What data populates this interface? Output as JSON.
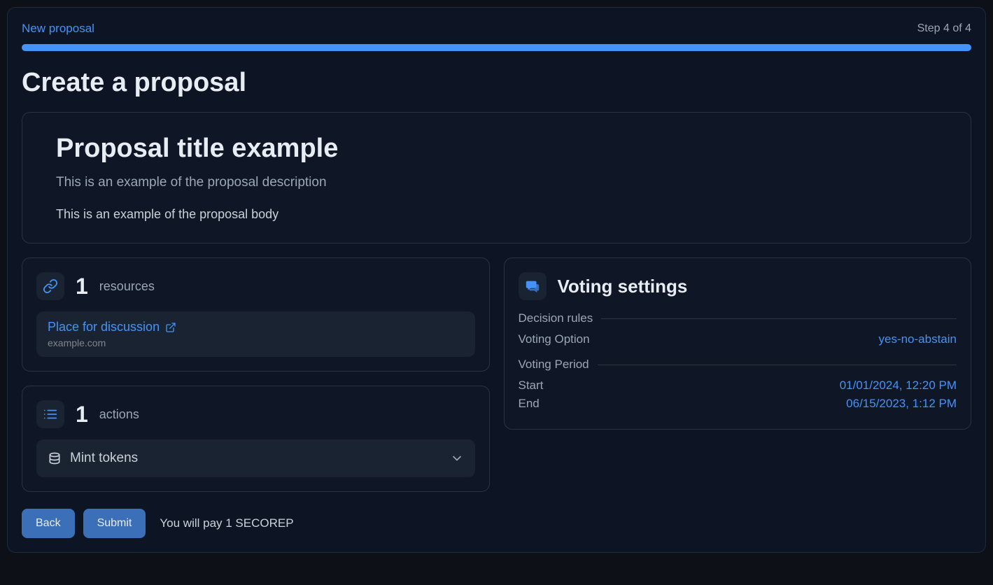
{
  "header": {
    "breadcrumb": "New proposal",
    "step_label": "Step 4 of 4"
  },
  "page_title": "Create a proposal",
  "proposal": {
    "title": "Proposal title example",
    "description": "This is an example of the proposal description",
    "body": "This is an example of the proposal body"
  },
  "resources": {
    "count": "1",
    "label": "resources",
    "items": [
      {
        "title": "Place for discussion",
        "domain": "example.com"
      }
    ]
  },
  "actions": {
    "count": "1",
    "label": "actions",
    "items": [
      {
        "name": "Mint tokens"
      }
    ]
  },
  "voting": {
    "title": "Voting settings",
    "decision_rules_label": "Decision rules",
    "voting_option_label": "Voting Option",
    "voting_option_value": "yes-no-abstain",
    "voting_period_label": "Voting Period",
    "start_label": "Start",
    "start_value": "01/01/2024, 12:20 PM",
    "end_label": "End",
    "end_value": "06/15/2023, 1:12 PM"
  },
  "footer": {
    "back_label": "Back",
    "submit_label": "Submit",
    "note": "You will pay 1 SECOREP"
  },
  "colors": {
    "accent": "#4493f8"
  }
}
